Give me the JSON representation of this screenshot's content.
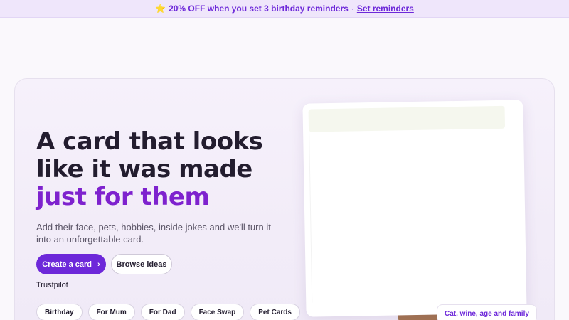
{
  "promo": {
    "icon": "star-icon",
    "text": "20% OFF when you set 3 birthday reminders",
    "separator": "·",
    "link": "Set reminders"
  },
  "hero": {
    "headline_line1": "A card that looks",
    "headline_line2": "like it was made",
    "headline_accent": "just for them",
    "subtext": "Add their face, pets, hobbies, inside jokes and we'll turn it into an unforgettable card.",
    "primary_button": "Create a card",
    "secondary_button": "Browse ideas",
    "trustpilot": "Trustpilot",
    "chips": [
      "Birthday",
      "For Mum",
      "For Dad",
      "Face Swap",
      "Pet Cards"
    ],
    "card_tag": "Cat, wine, age and family"
  },
  "colors": {
    "accent": "#6d28d9",
    "headline_accent": "#7e22ce",
    "promo_bg": "#efe6fb"
  }
}
